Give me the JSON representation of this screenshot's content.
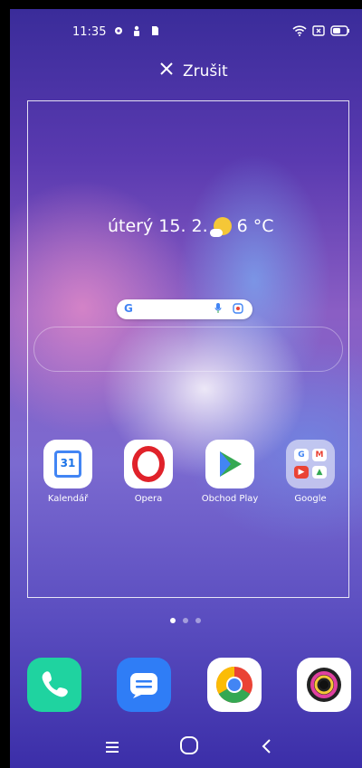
{
  "status_bar": {
    "time": "11:35",
    "left_icons": [
      "gear-icon",
      "person-icon",
      "sim-icon"
    ],
    "right_icons": [
      "wifi-icon",
      "nosim-icon",
      "battery-icon"
    ]
  },
  "header": {
    "cancel_label": "Zrušit"
  },
  "widget": {
    "date_text": "úterý 15. 2.",
    "weather_icon": "sun-cloud-icon",
    "temperature": "6 °C"
  },
  "search_bar": {
    "logo": "G"
  },
  "apps": [
    {
      "label": "Kalendář",
      "icon": "calendar-icon",
      "number": "31"
    },
    {
      "label": "Opera",
      "icon": "opera-icon"
    },
    {
      "label": "Obchod Play",
      "icon": "play-store-icon"
    },
    {
      "label": "Google",
      "icon": "google-folder-icon"
    }
  ],
  "page_indicator": {
    "pages": 3,
    "active": 1
  },
  "dock": [
    {
      "icon": "phone-icon",
      "color": "#1fd3a0"
    },
    {
      "icon": "messages-icon",
      "color": "#2f7df6"
    },
    {
      "icon": "chrome-icon",
      "color": "#ffffff"
    },
    {
      "icon": "camera-icon",
      "color": "#ffffff"
    }
  ],
  "colors": {
    "accent_yellow": "#f5c737",
    "opera_red": "#e0222a"
  }
}
